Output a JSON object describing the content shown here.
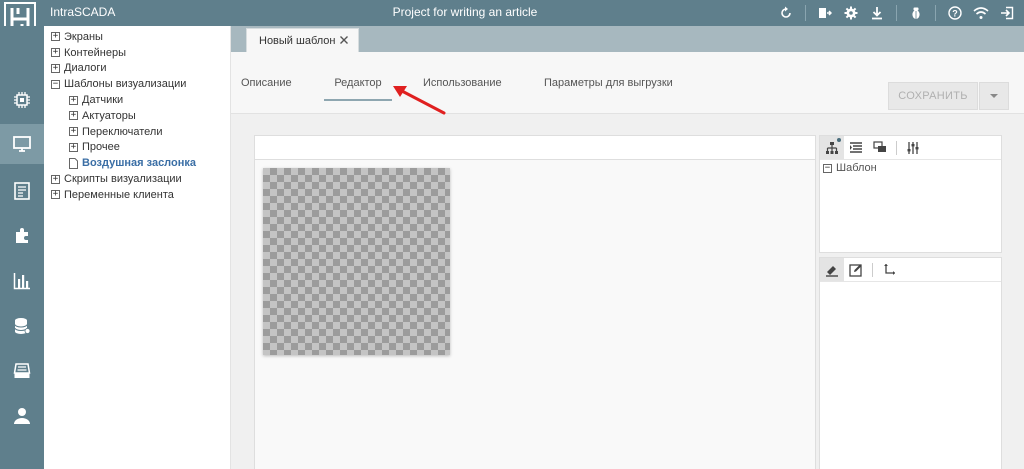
{
  "app": {
    "name": "IntraSCADA",
    "project_title": "Project for writing an article",
    "accent_color": "#5f7f8c",
    "top_icons": [
      "refresh-icon",
      "import-icon",
      "gear-icon",
      "download-icon",
      "bug-icon",
      "help-icon",
      "wifi-icon",
      "logout-icon"
    ]
  },
  "rail": {
    "items": [
      "cpu-icon",
      "monitor-icon",
      "document-icon",
      "puzzle-icon",
      "bar-chart-icon",
      "database-icon",
      "server-icon",
      "user-icon"
    ],
    "active": "monitor-icon"
  },
  "tree": {
    "items": [
      {
        "label": "Экраны",
        "level": 0,
        "state": "+"
      },
      {
        "label": "Контейнеры",
        "level": 0,
        "state": "+"
      },
      {
        "label": "Диалоги",
        "level": 0,
        "state": "+"
      },
      {
        "label": "Шаблоны визуализации",
        "level": 0,
        "state": "−"
      },
      {
        "label": "Датчики",
        "level": 1,
        "state": "+"
      },
      {
        "label": "Актуаторы",
        "level": 1,
        "state": "+"
      },
      {
        "label": "Переключатели",
        "level": 1,
        "state": "+"
      },
      {
        "label": "Прочее",
        "level": 1,
        "state": "+"
      },
      {
        "label": "Воздушная заслонка",
        "level": 1,
        "state": "doc",
        "selected": true
      },
      {
        "label": "Скрипты визуализации",
        "level": 0,
        "state": "+"
      },
      {
        "label": "Переменные клиента",
        "level": 0,
        "state": "+"
      }
    ]
  },
  "doc_tab": {
    "label": "Новый шаблон"
  },
  "subtabs": {
    "items": [
      "Описание",
      "Редактор",
      "Использование",
      "Параметры для выгрузки"
    ],
    "active": "Редактор"
  },
  "save": {
    "label": "СОХРАНИТЬ"
  },
  "structure_panel": {
    "tools": [
      "hierarchy-icon",
      "list-icon",
      "layers-icon",
      "sliders-icon"
    ],
    "root_node": "Шаблон"
  },
  "properties_panel": {
    "tools": [
      "paint-icon",
      "edit-icon",
      "move-icon"
    ]
  },
  "annotation": {
    "arrow_color": "#e02020"
  }
}
